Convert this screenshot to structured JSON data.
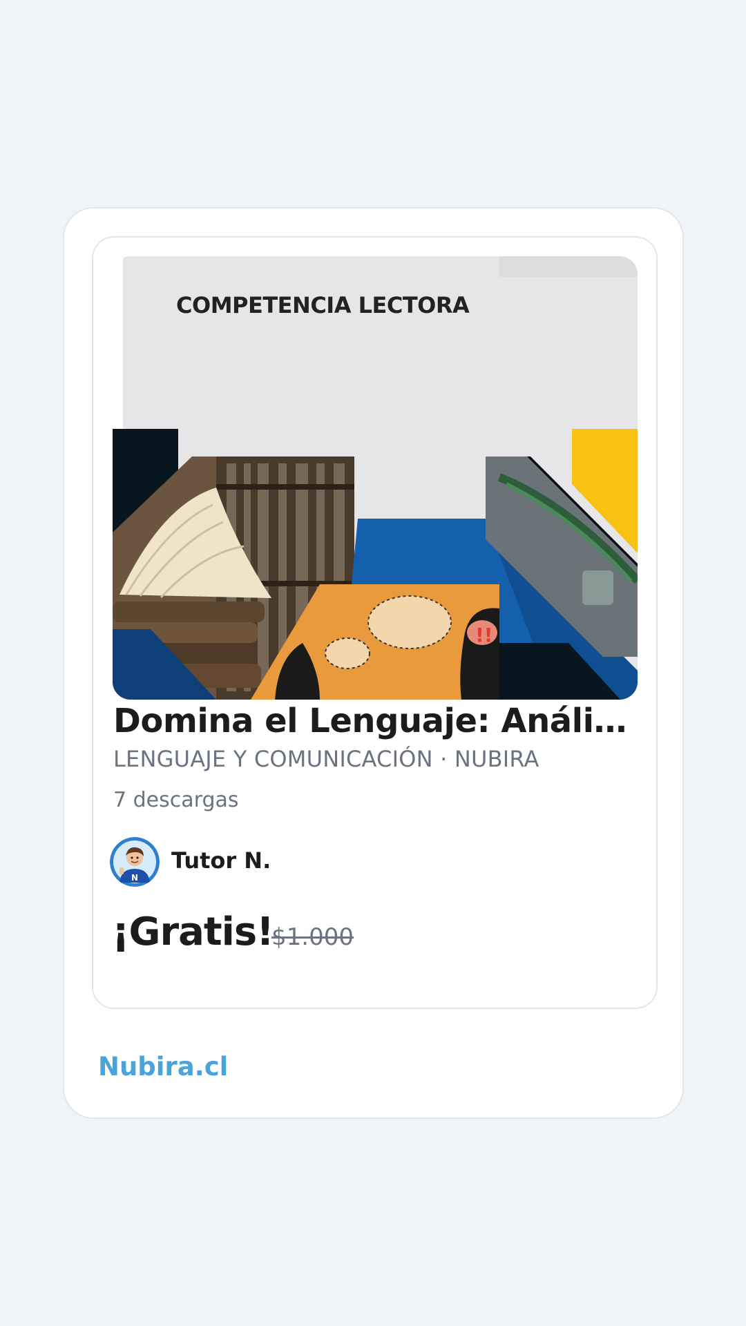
{
  "cover": {
    "heading": "COMPETENCIA LECTORA",
    "colors": {
      "background": "#e6e6e8",
      "navy": "#0b1d2b",
      "blue": "#1460ac",
      "yellow": "#f8c214",
      "orange": "#e89a3c"
    }
  },
  "product": {
    "title": "Domina el Lenguaje: Análisis...",
    "subtitle": "LENGUAJE Y COMUNICACIÓN · NUBIRA",
    "downloads": "7 descargas",
    "author": {
      "name": "Tutor N.",
      "avatar_icon": "tutor-avatar-icon"
    },
    "price": {
      "current": "¡Gratis!",
      "original": "$1.000"
    }
  },
  "footer": {
    "brand": "Nubira.cl",
    "brand_color": "#4aa3d9"
  }
}
